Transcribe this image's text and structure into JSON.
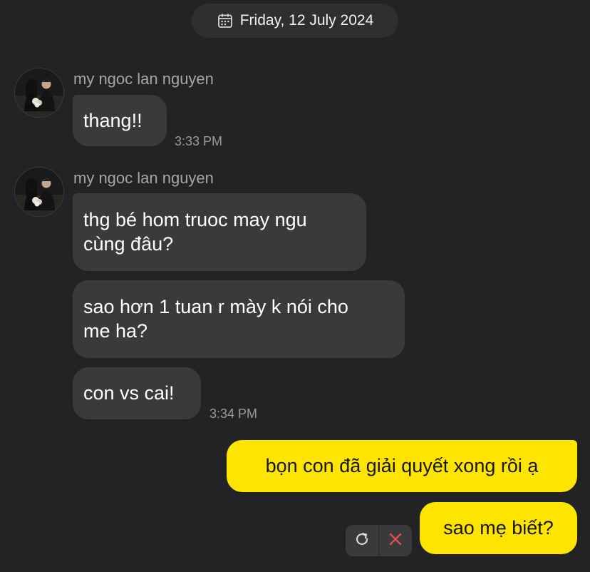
{
  "date_header": {
    "text": "Friday, 12 July 2024",
    "icon": "calendar-icon"
  },
  "groups": [
    {
      "sender": "my ngoc lan nguyen",
      "messages": [
        {
          "lines": [
            "thang!!"
          ]
        }
      ],
      "time": "3:33 PM"
    },
    {
      "sender": "my ngoc lan nguyen",
      "messages": [
        {
          "lines": [
            "thg bé hom truoc may ngu",
            "cùng đâu?"
          ]
        },
        {
          "lines": [
            "sao hơn 1 tuan r mày k nói cho",
            "me ha?"
          ]
        },
        {
          "lines": [
            "con vs cai!"
          ]
        }
      ],
      "time": "3:34 PM"
    }
  ],
  "outgoing": [
    {
      "text": "bọn con đã giải quyết xong rồi ạ"
    },
    {
      "text": "sao mẹ biết?"
    }
  ],
  "failed_actions": {
    "retry_icon": "retry-icon",
    "delete_icon": "close-icon"
  },
  "colors": {
    "background": "#232325",
    "incoming_bubble": "#3a3a3c",
    "outgoing_bubble": "#fee500",
    "delete_red": "#e0504a"
  }
}
